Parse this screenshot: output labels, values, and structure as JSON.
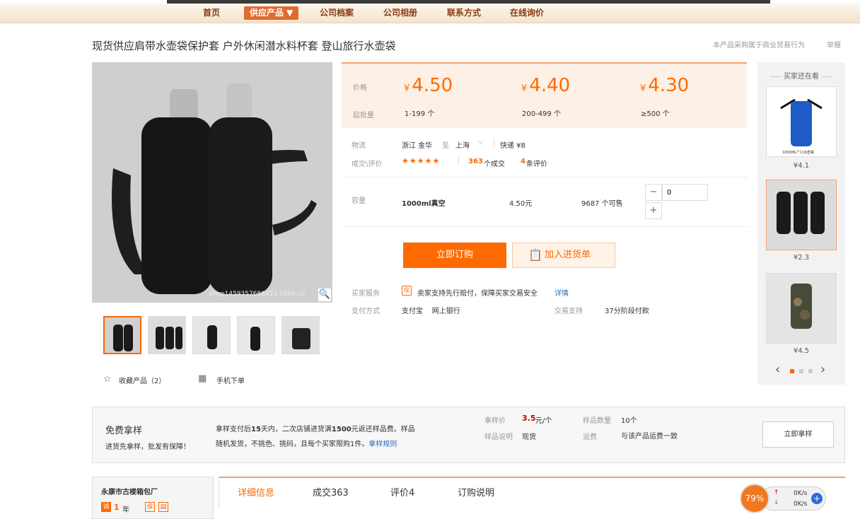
{
  "nav": {
    "items": [
      "首页",
      "供应产品 ▼",
      "公司档案",
      "公司相册",
      "联系方式",
      "在线询价"
    ]
  },
  "product": {
    "title": "现货供应肩带水壶袋保护套 户外休闲潜水料杯套 登山旅行水壶袋"
  },
  "topright": {
    "notice": "本产品采购属于商业贸易行为",
    "report": "举报"
  },
  "image": {
    "watermark": "shop1459357686433.1688.co"
  },
  "actions": {
    "favorite": "收藏产品（2）",
    "mobile": "手机下单"
  },
  "pricing": {
    "price_label": "价格",
    "moq_label": "起批量",
    "currency": "¥",
    "tiers": [
      {
        "price": "4.50",
        "qty": "1-199 个"
      },
      {
        "price": "4.40",
        "qty": "200-499 个"
      },
      {
        "price": "4.30",
        "qty": "≥500 个"
      }
    ]
  },
  "logistics": {
    "label": "物流",
    "origin": "浙江 金华",
    "to": "至",
    "dest": "上海",
    "method": "快递 ¥8"
  },
  "deals": {
    "label": "成交\\评价",
    "stars": "★★★★★",
    "count": "363",
    "count_suffix": "个成交",
    "reviews": "4",
    "reviews_suffix": "条评价"
  },
  "sku": {
    "label": "容量",
    "name": "1000ml真空",
    "price": "4.50元",
    "stock": "9687 个可售",
    "minus": "−",
    "plus": "+",
    "qty": "0"
  },
  "buttons": {
    "order": "立即订购",
    "cart": "加入进货单"
  },
  "service": {
    "label": "买家服务",
    "badge": "保",
    "text": "卖家支持先行赔付，保障买家交易安全",
    "link": "详情"
  },
  "payment": {
    "label": "支付方式",
    "methods": "支付宝    网上银行",
    "support_label": "交易支持",
    "support": "37分阶段付款"
  },
  "side": {
    "title": "买家还在看",
    "items": [
      {
        "price": "¥4.1",
        "caption": "1000ML广口水壶袋"
      },
      {
        "price": "¥2.3"
      },
      {
        "price": "¥4.5"
      }
    ],
    "prev": "‹",
    "next": "›"
  },
  "sample": {
    "title": "免费拿样",
    "subtitle": "进货先拿样，批发有保障！",
    "desc_a": "拿样支付后",
    "desc_b": "15",
    "desc_c": "天内，二次店铺进货满",
    "desc_d": "1500",
    "desc_e": "元返还样品费。样品",
    "desc2": "随机发货，不挑色、挑码，且每个买家限购1件。",
    "rules": "拿样规则",
    "price_label": "拿样价",
    "price": "3.5",
    "price_unit": "元/个",
    "qty_label": "样品数量",
    "qty": "10个",
    "desc_label": "样品说明",
    "desc_val": "现货",
    "ship_label": "运费",
    "ship_val": "与该产品运费一致",
    "btn": "立即拿样"
  },
  "company": {
    "name": "永康市古楼箱包厂",
    "years": "1",
    "years_unit": "年",
    "badge1": "诚",
    "badge2": "保"
  },
  "tabs": {
    "items": [
      "详细信息",
      "成交363",
      "评价4",
      "订购说明"
    ]
  },
  "speed": {
    "percent": "79%",
    "up": "0K/s",
    "down": "0K/s"
  },
  "colors": {
    "accent": "#ff6a00",
    "nav": "#8a3b14"
  }
}
